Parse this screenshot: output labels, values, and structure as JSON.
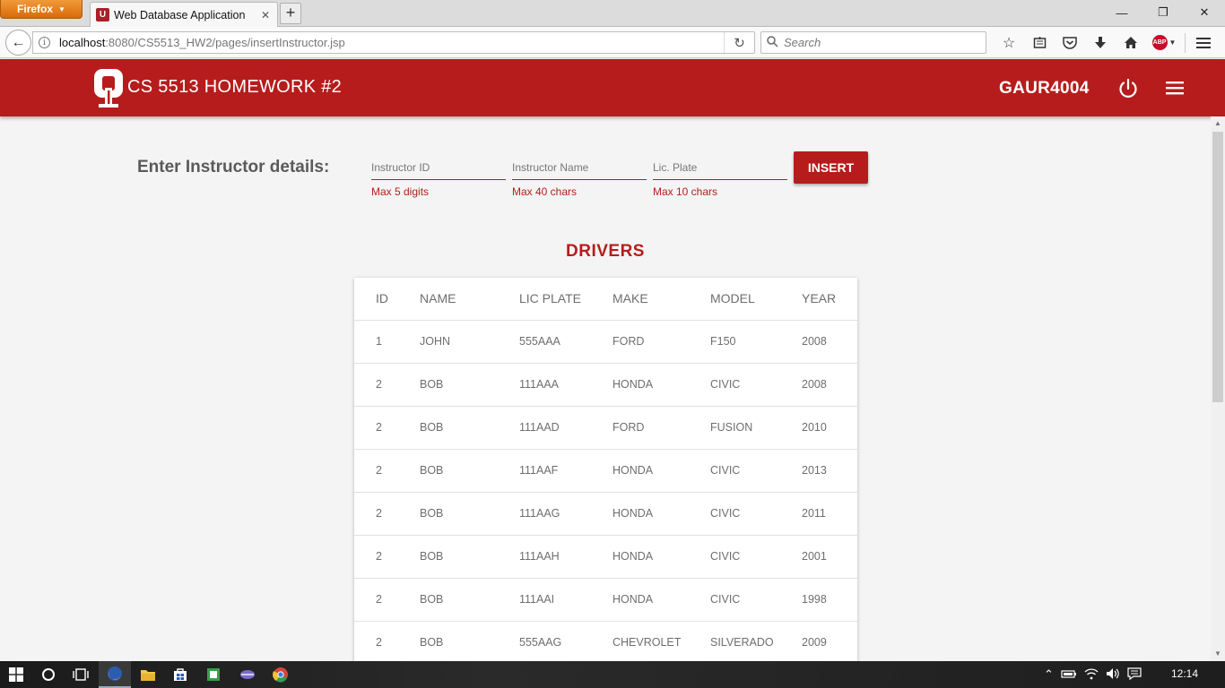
{
  "browser": {
    "menu_button": "Firefox",
    "tab_title": "Web Database Application",
    "url_host": "localhost",
    "url_rest": ":8080/CS5513_HW2/pages/insertInstructor.jsp",
    "search_placeholder": "Search",
    "toolbar_icons": [
      "bookmark-star-icon",
      "reading-list-icon",
      "pocket-icon",
      "download-icon",
      "home-icon",
      "adblock-icon",
      "hamburger-menu-icon"
    ],
    "abp_label": "ABP"
  },
  "header": {
    "title": "CS 5513 HOMEWORK #2",
    "user": "GAUR4004",
    "logo": "ou-logo",
    "brand_color": "#b71c1c"
  },
  "form": {
    "label": "Enter Instructor details:",
    "fields": [
      {
        "placeholder": "Instructor ID",
        "hint": "Max 5 digits"
      },
      {
        "placeholder": "Instructor Name",
        "hint": "Max 40 chars"
      },
      {
        "placeholder": "Lic. Plate",
        "hint": "Max 10 chars"
      }
    ],
    "insert_label": "INSERT"
  },
  "drivers": {
    "title": "DRIVERS",
    "columns": [
      "ID",
      "NAME",
      "LIC PLATE",
      "MAKE",
      "MODEL",
      "YEAR"
    ],
    "rows": [
      [
        "1",
        "JOHN",
        "555AAA",
        "FORD",
        "F150",
        "2008"
      ],
      [
        "2",
        "BOB",
        "111AAA",
        "HONDA",
        "CIVIC",
        "2008"
      ],
      [
        "2",
        "BOB",
        "111AAD",
        "FORD",
        "FUSION",
        "2010"
      ],
      [
        "2",
        "BOB",
        "111AAF",
        "HONDA",
        "CIVIC",
        "2013"
      ],
      [
        "2",
        "BOB",
        "111AAG",
        "HONDA",
        "CIVIC",
        "2011"
      ],
      [
        "2",
        "BOB",
        "111AAH",
        "HONDA",
        "CIVIC",
        "2001"
      ],
      [
        "2",
        "BOB",
        "111AAI",
        "HONDA",
        "CIVIC",
        "1998"
      ],
      [
        "2",
        "BOB",
        "555AAG",
        "CHEVROLET",
        "SILVERADO",
        "2009"
      ]
    ]
  },
  "taskbar": {
    "apps": [
      "windows-start-icon",
      "cortana-icon",
      "task-view-icon",
      "firefox-icon",
      "file-explorer-icon",
      "store-icon",
      "app-icon",
      "app-icon-2",
      "chrome-icon"
    ],
    "clock": "12:14"
  }
}
